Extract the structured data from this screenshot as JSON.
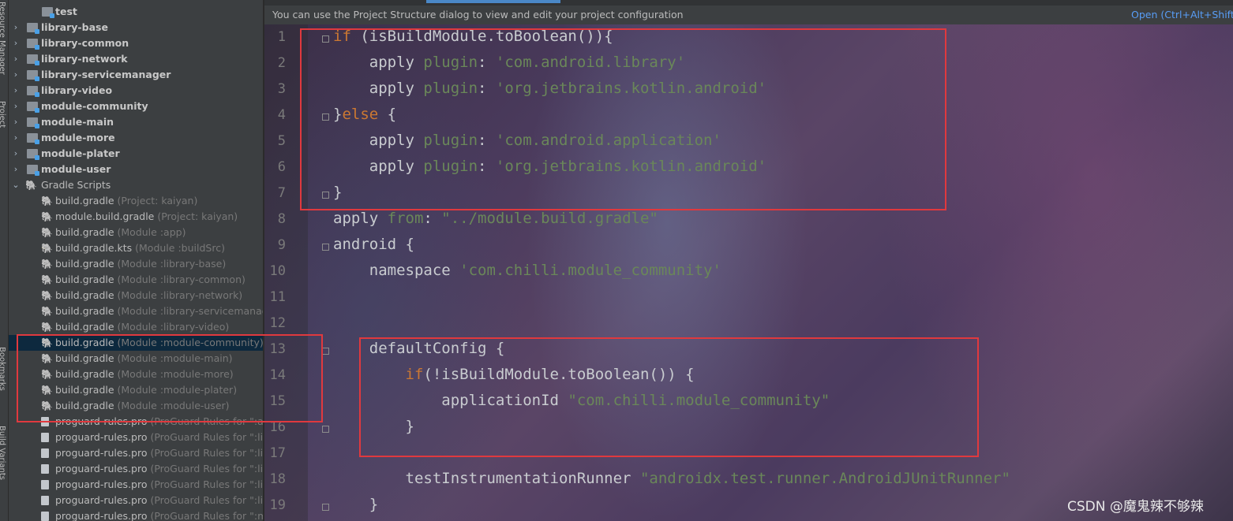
{
  "sidebar": {
    "vertical_tabs": [
      "Project",
      "Resource Manager",
      "Bookmarks",
      "Build Variants"
    ]
  },
  "tree": {
    "items": [
      {
        "kind": "folder",
        "name": "test",
        "hint": ""
      },
      {
        "kind": "module",
        "name": "library-base",
        "hint": ""
      },
      {
        "kind": "module",
        "name": "library-common",
        "hint": ""
      },
      {
        "kind": "module",
        "name": "library-network",
        "hint": ""
      },
      {
        "kind": "module",
        "name": "library-servicemanager",
        "hint": ""
      },
      {
        "kind": "module",
        "name": "library-video",
        "hint": ""
      },
      {
        "kind": "module",
        "name": "module-community",
        "hint": ""
      },
      {
        "kind": "module",
        "name": "module-main",
        "hint": ""
      },
      {
        "kind": "module",
        "name": "module-more",
        "hint": ""
      },
      {
        "kind": "module",
        "name": "module-plater",
        "hint": ""
      },
      {
        "kind": "module",
        "name": "module-user",
        "hint": ""
      },
      {
        "kind": "group",
        "name": "Gradle Scripts",
        "hint": ""
      },
      {
        "kind": "gradle",
        "name": "build.gradle",
        "hint": "(Project: kaiyan)"
      },
      {
        "kind": "gradle",
        "name": "module.build.gradle",
        "hint": "(Project: kaiyan)"
      },
      {
        "kind": "gradle",
        "name": "build.gradle",
        "hint": "(Module :app)"
      },
      {
        "kind": "kts",
        "name": "build.gradle.kts",
        "hint": "(Module :buildSrc)"
      },
      {
        "kind": "gradle",
        "name": "build.gradle",
        "hint": "(Module :library-base)"
      },
      {
        "kind": "gradle",
        "name": "build.gradle",
        "hint": "(Module :library-common)"
      },
      {
        "kind": "gradle",
        "name": "build.gradle",
        "hint": "(Module :library-network)"
      },
      {
        "kind": "gradle",
        "name": "build.gradle",
        "hint": "(Module :library-servicemanager)"
      },
      {
        "kind": "gradle",
        "name": "build.gradle",
        "hint": "(Module :library-video)"
      },
      {
        "kind": "gradle",
        "name": "build.gradle",
        "hint": "(Module :module-community)",
        "selected": true
      },
      {
        "kind": "gradle",
        "name": "build.gradle",
        "hint": "(Module :module-main)"
      },
      {
        "kind": "gradle",
        "name": "build.gradle",
        "hint": "(Module :module-more)"
      },
      {
        "kind": "gradle",
        "name": "build.gradle",
        "hint": "(Module :module-plater)"
      },
      {
        "kind": "gradle",
        "name": "build.gradle",
        "hint": "(Module :module-user)"
      },
      {
        "kind": "file",
        "name": "proguard-rules.pro",
        "hint": "(ProGuard Rules for \":ap"
      },
      {
        "kind": "file",
        "name": "proguard-rules.pro",
        "hint": "(ProGuard Rules for \":libr"
      },
      {
        "kind": "file",
        "name": "proguard-rules.pro",
        "hint": "(ProGuard Rules for \":libr"
      },
      {
        "kind": "file",
        "name": "proguard-rules.pro",
        "hint": "(ProGuard Rules for \":libr"
      },
      {
        "kind": "file",
        "name": "proguard-rules.pro",
        "hint": "(ProGuard Rules for \":libr"
      },
      {
        "kind": "file",
        "name": "proguard-rules.pro",
        "hint": "(ProGuard Rules for \":libr"
      },
      {
        "kind": "file",
        "name": "proguard-rules.pro",
        "hint": "(ProGuard Rules for \":mo"
      }
    ]
  },
  "banner": {
    "message": "You can use the Project Structure dialog to view and edit your project configuration",
    "open_link": "Open (Ctrl+Alt+Shift+S)"
  },
  "editor": {
    "lines": [
      {
        "n": "1",
        "tokens": [
          {
            "t": "kw",
            "v": "if"
          },
          {
            "t": "p",
            "v": " (isBuildModule.toBoolean()){"
          }
        ]
      },
      {
        "n": "2",
        "tokens": [
          {
            "t": "p",
            "v": "    apply "
          },
          {
            "t": "grn",
            "v": "plugin"
          },
          {
            "t": "p",
            "v": ": "
          },
          {
            "t": "str",
            "v": "'com.android.library'"
          }
        ]
      },
      {
        "n": "3",
        "tokens": [
          {
            "t": "p",
            "v": "    apply "
          },
          {
            "t": "grn",
            "v": "plugin"
          },
          {
            "t": "p",
            "v": ": "
          },
          {
            "t": "str",
            "v": "'org.jetbrains.kotlin.android'"
          }
        ]
      },
      {
        "n": "4",
        "tokens": [
          {
            "t": "p",
            "v": "}"
          },
          {
            "t": "kw",
            "v": "else"
          },
          {
            "t": "p",
            "v": " {"
          }
        ]
      },
      {
        "n": "5",
        "tokens": [
          {
            "t": "p",
            "v": "    apply "
          },
          {
            "t": "grn",
            "v": "plugin"
          },
          {
            "t": "p",
            "v": ": "
          },
          {
            "t": "str",
            "v": "'com.android.application'"
          }
        ]
      },
      {
        "n": "6",
        "tokens": [
          {
            "t": "p",
            "v": "    apply "
          },
          {
            "t": "grn",
            "v": "plugin"
          },
          {
            "t": "p",
            "v": ": "
          },
          {
            "t": "str",
            "v": "'org.jetbrains.kotlin.android'"
          }
        ]
      },
      {
        "n": "7",
        "tokens": [
          {
            "t": "p",
            "v": "}"
          }
        ]
      },
      {
        "n": "8",
        "tokens": [
          {
            "t": "p",
            "v": "apply "
          },
          {
            "t": "grn",
            "v": "from"
          },
          {
            "t": "p",
            "v": ": "
          },
          {
            "t": "str",
            "v": "\"../module.build.gradle\""
          }
        ]
      },
      {
        "n": "9",
        "tokens": [
          {
            "t": "p",
            "v": "android {"
          }
        ]
      },
      {
        "n": "10",
        "tokens": [
          {
            "t": "p",
            "v": "    namespace "
          },
          {
            "t": "str",
            "v": "'com.chilli.module_community'"
          }
        ]
      },
      {
        "n": "11",
        "tokens": []
      },
      {
        "n": "12",
        "tokens": []
      },
      {
        "n": "13",
        "tokens": [
          {
            "t": "p",
            "v": "    defaultConfig {"
          }
        ]
      },
      {
        "n": "14",
        "tokens": [
          {
            "t": "p",
            "v": "        "
          },
          {
            "t": "kw",
            "v": "if"
          },
          {
            "t": "p",
            "v": "(!isBuildModule.toBoolean()) {"
          }
        ]
      },
      {
        "n": "15",
        "tokens": [
          {
            "t": "p",
            "v": "            applicationId "
          },
          {
            "t": "str",
            "v": "\"com.chilli.module_community\""
          }
        ]
      },
      {
        "n": "16",
        "tokens": [
          {
            "t": "p",
            "v": "        }"
          }
        ]
      },
      {
        "n": "17",
        "tokens": []
      },
      {
        "n": "18",
        "tokens": [
          {
            "t": "p",
            "v": "        testInstrumentationRunner "
          },
          {
            "t": "str",
            "v": "\"androidx.test.runner.AndroidJUnitRunner\""
          }
        ]
      },
      {
        "n": "19",
        "tokens": [
          {
            "t": "p",
            "v": "    }"
          }
        ]
      }
    ]
  },
  "watermark": "CSDN @魔鬼辣不够辣",
  "colors": {
    "keyword": "#cc7832",
    "string": "#6a8759",
    "highlight_box": "#e0393e",
    "selection": "#0d293e",
    "link": "#589df6"
  }
}
